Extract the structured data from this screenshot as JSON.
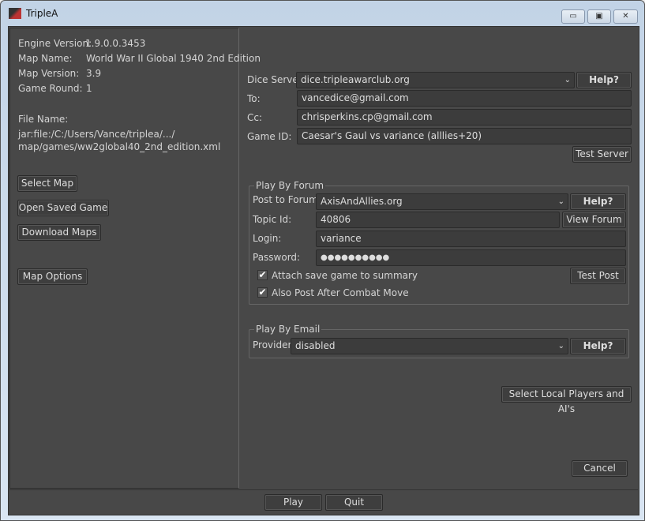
{
  "window": {
    "title": "TripleA",
    "minimize": "▭",
    "maximize": "▣",
    "close": "✕"
  },
  "info": {
    "engine_label": "Engine Version:",
    "engine_value": "1.9.0.0.3453",
    "map_name_label": "Map Name:",
    "map_name_value": "World War II Global 1940 2nd Edition",
    "map_version_label": "Map Version:",
    "map_version_value": "3.9",
    "round_label": "Game Round:",
    "round_value": "1",
    "file_label": "File Name:",
    "file_line1": "jar:file:/C:/Users/Vance/triplea/.../",
    "file_line2": "map/games/ww2global40_2nd_edition.xml"
  },
  "left_buttons": {
    "select_map": "Select Map",
    "open_saved": "Open Saved Game",
    "download_maps": "Download Maps",
    "map_options": "Map Options"
  },
  "dice": {
    "server_label": "Dice Server:",
    "server_value": "dice.tripleawarclub.org",
    "help": "Help?",
    "to_label": "To:",
    "to_value": "vancedice@gmail.com",
    "cc_label": "Cc:",
    "cc_value": "chrisperkins.cp@gmail.com",
    "game_id_label": "Game ID:",
    "game_id_value": "Caesar's Gaul vs variance (alllies+20)",
    "test_server": "Test Server"
  },
  "forum": {
    "legend": "Play By Forum",
    "post_label": "Post to Forum:",
    "post_value": "AxisAndAllies.org",
    "help": "Help?",
    "topic_label": "Topic Id:",
    "topic_value": "40806",
    "view_forum": "View Forum",
    "login_label": "Login:",
    "login_value": "variance",
    "password_label": "Password:",
    "password_value": "●●●●●●●●●●",
    "attach_label": "Attach save game to summary",
    "attach_checked": true,
    "also_post_label": "Also Post After Combat Move",
    "also_post_checked": true,
    "test_post": "Test Post"
  },
  "email": {
    "legend": "Play By Email",
    "provider_label": "Provider:",
    "provider_value": "disabled",
    "help": "Help?"
  },
  "actions": {
    "select_players": "Select Local Players and AI's",
    "cancel": "Cancel",
    "play": "Play",
    "quit": "Quit"
  },
  "check_mark": "✔",
  "dropdown_arrow": "⌄"
}
